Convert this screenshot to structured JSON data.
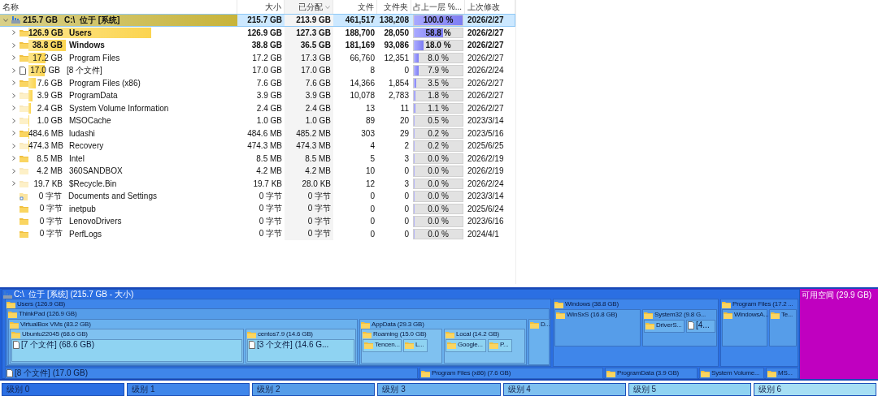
{
  "table": {
    "columns": [
      {
        "label": "名称",
        "sorted": false
      },
      {
        "label": "大小",
        "sorted": false
      },
      {
        "label": "已分配",
        "sorted": true
      },
      {
        "label": "文件",
        "sorted": false
      },
      {
        "label": "文件夹",
        "sorted": false
      },
      {
        "label": "占上一层 %...",
        "sorted": false
      },
      {
        "label": "上次修改",
        "sorted": false
      }
    ],
    "root": {
      "name": "C:\\  位于 [系统]",
      "name_size": "215.7 GB",
      "size": "215.7 GB",
      "allocated": "213.9 GB",
      "files": "461,517",
      "folders": "138,208",
      "percent": "100.0 %",
      "level": 1,
      "modified": "2026/2/27",
      "bold": true,
      "selected": true,
      "expanded": true,
      "kind": "drive",
      "children": [
        {
          "name": "Users",
          "name_size": "126.9 GB",
          "size": "126.9 GB",
          "allocated": "127.3 GB",
          "files": "188,700",
          "folders": "28,050",
          "percent": "58.8 %",
          "level": 0.588,
          "modified": "2026/2/27",
          "bold": true,
          "selected": false,
          "kind": "folder",
          "hidden": false,
          "expandable": true
        },
        {
          "name": "Windows",
          "name_size": "38.8 GB",
          "size": "38.8 GB",
          "allocated": "36.5 GB",
          "files": "181,169",
          "folders": "93,086",
          "percent": "18.0 %",
          "level": 0.18,
          "modified": "2026/2/27",
          "bold": true,
          "selected": false,
          "kind": "folder",
          "hidden": false,
          "expandable": true
        },
        {
          "name": "Program Files",
          "name_size": "17.2 GB",
          "size": "17.2 GB",
          "allocated": "17.3 GB",
          "files": "66,760",
          "folders": "12,351",
          "percent": "8.0 %",
          "level": 0.08,
          "modified": "2026/2/27",
          "bold": false,
          "selected": false,
          "kind": "folder",
          "hidden": false,
          "expandable": true
        },
        {
          "name": "[8 个文件]",
          "name_size": "17.0 GB",
          "size": "17.0 GB",
          "allocated": "17.0 GB",
          "files": "8",
          "folders": "0",
          "percent": "7.9 %",
          "level": 0.079,
          "modified": "2026/2/24",
          "bold": false,
          "selected": false,
          "kind": "file",
          "hidden": false,
          "expandable": true
        },
        {
          "name": "Program Files (x86)",
          "name_size": "7.6 GB",
          "size": "7.6 GB",
          "allocated": "7.6 GB",
          "files": "14,366",
          "folders": "1,854",
          "percent": "3.5 %",
          "level": 0.035,
          "modified": "2026/2/27",
          "bold": false,
          "selected": false,
          "kind": "folder",
          "hidden": false,
          "expandable": true
        },
        {
          "name": "ProgramData",
          "name_size": "3.9 GB",
          "size": "3.9 GB",
          "allocated": "3.9 GB",
          "files": "10,078",
          "folders": "2,783",
          "percent": "1.8 %",
          "level": 0.018,
          "modified": "2026/2/27",
          "bold": false,
          "selected": false,
          "kind": "folder",
          "hidden": true,
          "expandable": true
        },
        {
          "name": "System Volume Information",
          "name_size": "2.4 GB",
          "size": "2.4 GB",
          "allocated": "2.4 GB",
          "files": "13",
          "folders": "11",
          "percent": "1.1 %",
          "level": 0.011,
          "modified": "2026/2/27",
          "bold": false,
          "selected": false,
          "kind": "folder",
          "hidden": true,
          "expandable": true
        },
        {
          "name": "MSOCache",
          "name_size": "1.0 GB",
          "size": "1.0 GB",
          "allocated": "1.0 GB",
          "files": "89",
          "folders": "20",
          "percent": "0.5 %",
          "level": 0.005,
          "modified": "2023/3/14",
          "bold": false,
          "selected": false,
          "kind": "folder",
          "hidden": true,
          "expandable": true
        },
        {
          "name": "ludashi",
          "name_size": "484.6 MB",
          "size": "484.6 MB",
          "allocated": "485.2 MB",
          "files": "303",
          "folders": "29",
          "percent": "0.2 %",
          "level": 0.002,
          "modified": "2023/5/16",
          "bold": false,
          "selected": false,
          "kind": "folder",
          "hidden": false,
          "expandable": true
        },
        {
          "name": "Recovery",
          "name_size": "474.3 MB",
          "size": "474.3 MB",
          "allocated": "474.3 MB",
          "files": "4",
          "folders": "2",
          "percent": "0.2 %",
          "level": 0.002,
          "modified": "2025/6/25",
          "bold": false,
          "selected": false,
          "kind": "folder",
          "hidden": true,
          "expandable": true
        },
        {
          "name": "Intel",
          "name_size": "8.5 MB",
          "size": "8.5 MB",
          "allocated": "8.5 MB",
          "files": "5",
          "folders": "3",
          "percent": "0.0 %",
          "level": 0,
          "modified": "2026/2/19",
          "bold": false,
          "selected": false,
          "kind": "folder",
          "hidden": false,
          "expandable": true
        },
        {
          "name": "360SANDBOX",
          "name_size": "4.2 MB",
          "size": "4.2 MB",
          "allocated": "4.2 MB",
          "files": "10",
          "folders": "0",
          "percent": "0.0 %",
          "level": 0,
          "modified": "2026/2/19",
          "bold": false,
          "selected": false,
          "kind": "folder",
          "hidden": true,
          "expandable": true
        },
        {
          "name": "$Recycle.Bin",
          "name_size": "19.7 KB",
          "size": "19.7 KB",
          "allocated": "28.0 KB",
          "files": "12",
          "folders": "3",
          "percent": "0.0 %",
          "level": 0,
          "modified": "2026/2/24",
          "bold": false,
          "selected": false,
          "kind": "folder",
          "hidden": true,
          "expandable": true
        },
        {
          "name": "Documents and Settings",
          "name_size": "0 字节",
          "size": "0 字节",
          "allocated": "0 字节",
          "files": "0",
          "folders": "0",
          "percent": "0.0 %",
          "level": 0,
          "modified": "2023/3/14",
          "bold": false,
          "selected": false,
          "kind": "shortcut",
          "hidden": false,
          "expandable": false
        },
        {
          "name": "inetpub",
          "name_size": "0 字节",
          "size": "0 字节",
          "allocated": "0 字节",
          "files": "0",
          "folders": "0",
          "percent": "0.0 %",
          "level": 0,
          "modified": "2025/6/24",
          "bold": false,
          "selected": false,
          "kind": "folder",
          "hidden": false,
          "expandable": false
        },
        {
          "name": "LenovoDrivers",
          "name_size": "0 字节",
          "size": "0 字节",
          "allocated": "0 字节",
          "files": "0",
          "folders": "0",
          "percent": "0.0 %",
          "level": 0,
          "modified": "2023/6/16",
          "bold": false,
          "selected": false,
          "kind": "folder",
          "hidden": false,
          "expandable": false
        },
        {
          "name": "PerfLogs",
          "name_size": "0 字节",
          "size": "0 字节",
          "allocated": "0 字节",
          "files": "0",
          "folders": "0",
          "percent": "0.0 %",
          "level": 0,
          "modified": "2024/4/1",
          "bold": false,
          "selected": false,
          "kind": "folder",
          "hidden": false,
          "expandable": false
        }
      ]
    }
  },
  "treemap": {
    "root": {
      "label": "C:\\  位于 [系统] (215.7 GB - 大小)",
      "kind": "drive",
      "children": [
        {
          "label": "Users (126.9 GB)",
          "kind": "folder",
          "children": [
            {
              "label": "ThinkPad (126.9 GB)",
              "kind": "folder",
              "children": [
                {
                  "label": "VirtualBox VMs (83.2 GB)",
                  "kind": "folder",
                  "children": [
                    {
                      "label": "Ubuntu22045 (68.6 GB)",
                      "kind": "folder",
                      "children": [
                        {
                          "label": "[7 个文件] (68.6 GB)",
                          "kind": "file"
                        }
                      ]
                    },
                    {
                      "label": "centos7.9 (14.6 GB)",
                      "kind": "folder",
                      "children": [
                        {
                          "label": "[3 个文件] (14.6 G...",
                          "kind": "file"
                        }
                      ]
                    }
                  ]
                },
                {
                  "label": "AppData (29.3 GB)",
                  "kind": "folder",
                  "children": [
                    {
                      "label": "Roaming (15.0 GB)",
                      "kind": "folder",
                      "children": [
                        {
                          "label": "Tencen...",
                          "kind": "folder"
                        },
                        {
                          "label": "L...",
                          "kind": "folder"
                        }
                      ]
                    },
                    {
                      "label": "Local (14.2 GB)",
                      "kind": "folder",
                      "children": [
                        {
                          "label": "Google...",
                          "kind": "folder"
                        },
                        {
                          "label": "P...",
                          "kind": "folder"
                        }
                      ]
                    }
                  ]
                },
                {
                  "label": "D...",
                  "kind": "folder"
                }
              ]
            }
          ]
        },
        {
          "label": "Windows (38.8 GB)",
          "kind": "folder",
          "children": [
            {
              "label": "WinSxS (16.8 GB)",
              "kind": "folder"
            },
            {
              "label": "System32 (9.8 G...",
              "kind": "folder",
              "children": [
                {
                  "label": "DriverS...",
                  "kind": "folder"
                },
                {
                  "label": "[4...",
                  "kind": "file"
                }
              ]
            }
          ]
        },
        {
          "label": "Program Files (17.2 ...",
          "kind": "folder",
          "children": [
            {
              "label": "WindowsA...",
              "kind": "folder"
            },
            {
              "label": "Te...",
              "kind": "folder"
            }
          ]
        },
        {
          "label": "[8 个文件] (17.0 GB)",
          "kind": "file"
        },
        {
          "label": "Program Files (x86) (7.6 GB)",
          "kind": "folder"
        },
        {
          "label": "ProgramData (3.9 GB)",
          "kind": "folder"
        },
        {
          "label": "System Volume...",
          "kind": "folder"
        },
        {
          "label": "MS...",
          "kind": "folder"
        }
      ]
    },
    "free_space": {
      "label": "可用空间 (29.9 GB)",
      "color": "#c000c0"
    }
  },
  "legend": [
    {
      "label": "级别 0",
      "color": "#2b6fe3"
    },
    {
      "label": "级别 1",
      "color": "#3f86ea"
    },
    {
      "label": "级别 2",
      "color": "#569de9"
    },
    {
      "label": "级别 3",
      "color": "#6ab1ee"
    },
    {
      "label": "级别 4",
      "color": "#7fc1f0"
    },
    {
      "label": "级别 5",
      "color": "#8fd3f2"
    },
    {
      "label": "级别 6",
      "color": "#a6dff4"
    }
  ]
}
